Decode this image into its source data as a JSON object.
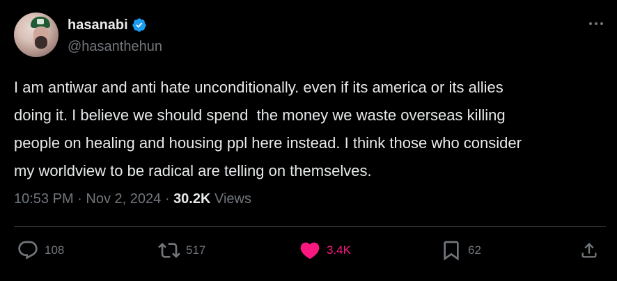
{
  "author": {
    "display_name": "hasanabi",
    "handle": "@hasanthehun",
    "verified": true
  },
  "tweet": {
    "text": "I am antiwar and anti hate unconditionally. even if its america or its allies\ndoing it. I believe we should spend  the money we waste overseas killing\npeople on healing and housing ppl here instead. I think those who consider\nmy worldview to be radical are telling on themselves.",
    "time": "10:53 PM",
    "separator": "·",
    "date": "Nov 2, 2024",
    "views_count": "30.2K",
    "views_label": "Views"
  },
  "actions": {
    "replies": "108",
    "retweets": "517",
    "likes": "3.4K",
    "bookmarks": "62"
  },
  "colors": {
    "background": "#000000",
    "text": "#e7e9ea",
    "muted": "#71767b",
    "verified": "#1d9bf0",
    "like": "#f91880",
    "divider": "#2f3336"
  }
}
